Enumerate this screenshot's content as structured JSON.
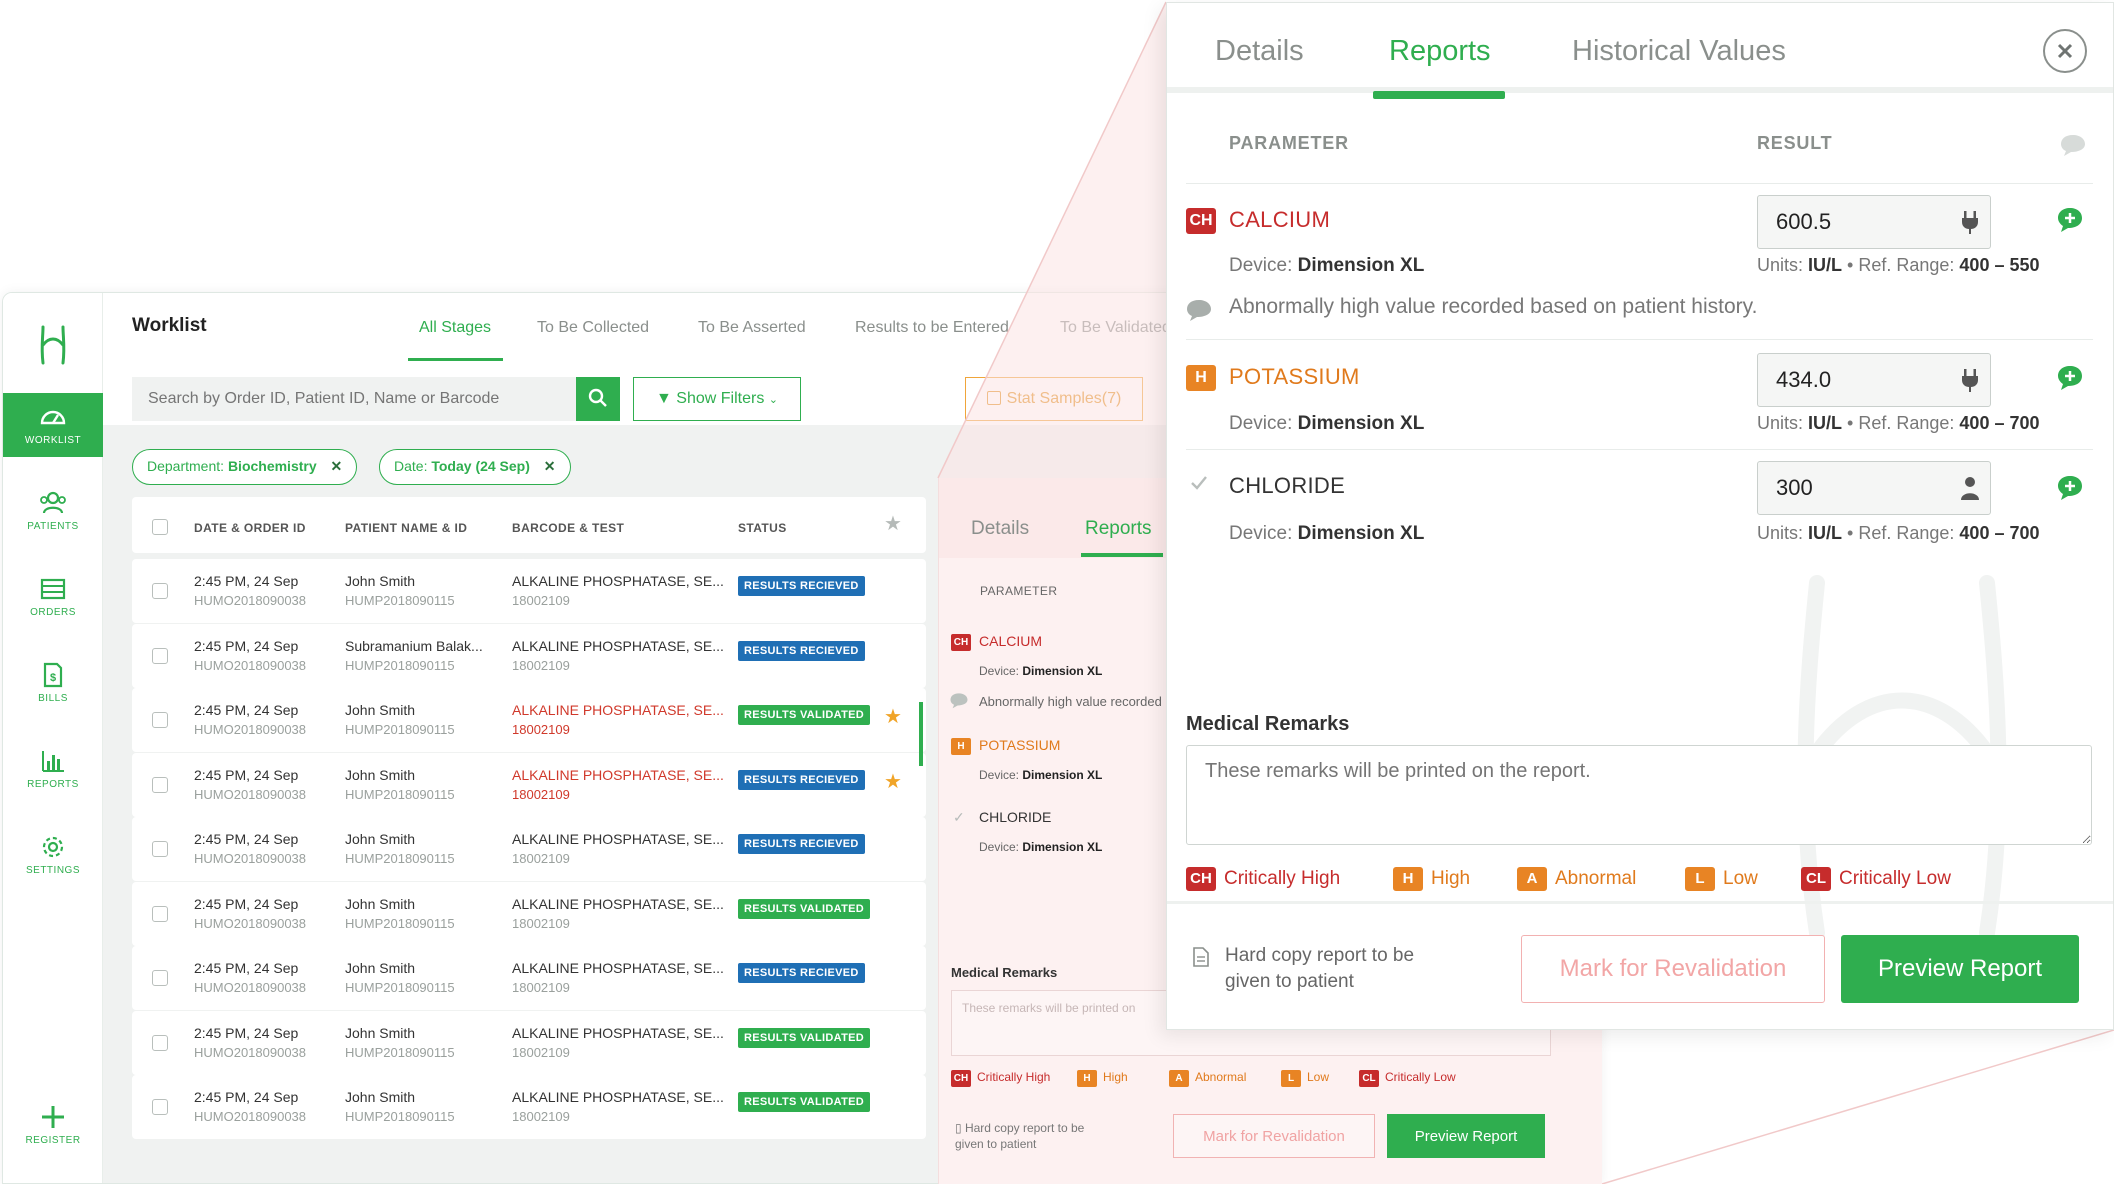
{
  "app": {
    "brand_color": "#2fae4f",
    "sidebar": [
      {
        "label": "WORKLIST",
        "icon": "gauge-icon",
        "active": true
      },
      {
        "label": "PATIENTS",
        "icon": "users-icon"
      },
      {
        "label": "ORDERS",
        "icon": "inbox-icon"
      },
      {
        "label": "BILLS",
        "icon": "bill-icon"
      },
      {
        "label": "REPORTS",
        "icon": "bar-chart-icon"
      },
      {
        "label": "SETTINGS",
        "icon": "gear-icon"
      },
      {
        "label": "REGISTER",
        "icon": "plus-icon"
      }
    ],
    "worklist": {
      "title": "Worklist",
      "stages": [
        "All Stages",
        "To Be Collected",
        "To Be Asserted",
        "Results to be Entered",
        "To Be Validated"
      ],
      "search_placeholder": "Search by Order ID, Patient ID, Name or Barcode",
      "show_filters": "Show Filters",
      "stat_samples": "Stat Samples(7)",
      "chips": [
        {
          "label": "Department:",
          "value": "Biochemistry"
        },
        {
          "label": "Date:",
          "value": "Today (24 Sep)"
        }
      ],
      "columns": [
        "DATE & ORDER ID",
        "PATIENT NAME & ID",
        "BARCODE & TEST",
        "STATUS"
      ],
      "rows": [
        {
          "date": "2:45 PM, 24 Sep",
          "order": "HUMO2018090038",
          "name": "John Smith",
          "pid": "HUMP2018090115",
          "test": "ALKALINE PHOSPHATASE, SE...",
          "barcode": "18002109",
          "status": "RESULTS RECIEVED",
          "kind": "rec",
          "red": false,
          "star": false
        },
        {
          "date": "2:45 PM, 24 Sep",
          "order": "HUMO2018090038",
          "name": "Subramanium Balak...",
          "pid": "HUMP2018090115",
          "test": "ALKALINE PHOSPHATASE, SE...",
          "barcode": "18002109",
          "status": "RESULTS RECIEVED",
          "kind": "rec",
          "red": false,
          "star": false
        },
        {
          "date": "2:45 PM, 24 Sep",
          "order": "HUMO2018090038",
          "name": "John Smith",
          "pid": "HUMP2018090115",
          "test": "ALKALINE PHOSPHATASE, SE...",
          "barcode": "18002109",
          "status": "RESULTS VALIDATED",
          "kind": "val",
          "red": true,
          "star": true
        },
        {
          "date": "2:45 PM, 24 Sep",
          "order": "HUMO2018090038",
          "name": "John Smith",
          "pid": "HUMP2018090115",
          "test": "ALKALINE PHOSPHATASE, SE...",
          "barcode": "18002109",
          "status": "RESULTS RECIEVED",
          "kind": "rec",
          "red": true,
          "star": true
        },
        {
          "date": "2:45 PM, 24 Sep",
          "order": "HUMO2018090038",
          "name": "John Smith",
          "pid": "HUMP2018090115",
          "test": "ALKALINE PHOSPHATASE, SE...",
          "barcode": "18002109",
          "status": "RESULTS RECIEVED",
          "kind": "rec",
          "red": false,
          "star": false
        },
        {
          "date": "2:45 PM, 24 Sep",
          "order": "HUMO2018090038",
          "name": "John Smith",
          "pid": "HUMP2018090115",
          "test": "ALKALINE PHOSPHATASE, SE...",
          "barcode": "18002109",
          "status": "RESULTS VALIDATED",
          "kind": "val",
          "red": false,
          "star": false
        },
        {
          "date": "2:45 PM, 24 Sep",
          "order": "HUMO2018090038",
          "name": "John Smith",
          "pid": "HUMP2018090115",
          "test": "ALKALINE PHOSPHATASE, SE...",
          "barcode": "18002109",
          "status": "RESULTS RECIEVED",
          "kind": "rec",
          "red": false,
          "star": false
        },
        {
          "date": "2:45 PM, 24 Sep",
          "order": "HUMO2018090038",
          "name": "John Smith",
          "pid": "HUMP2018090115",
          "test": "ALKALINE PHOSPHATASE, SE...",
          "barcode": "18002109",
          "status": "RESULTS VALIDATED",
          "kind": "val",
          "red": false,
          "star": false
        },
        {
          "date": "2:45 PM, 24 Sep",
          "order": "HUMO2018090038",
          "name": "John Smith",
          "pid": "HUMP2018090115",
          "test": "ALKALINE PHOSPHATASE, SE...",
          "barcode": "18002109",
          "status": "RESULTS VALIDATED",
          "kind": "val",
          "red": false,
          "star": false
        }
      ]
    }
  },
  "mini_panel": {
    "tabs": [
      "Details",
      "Reports"
    ],
    "param_header": "PARAMETER",
    "params": [
      {
        "tag": "CH",
        "name": "CALCIUM",
        "device_label": "Device:",
        "device": "Dimension XL"
      },
      {
        "tag": "H",
        "name": "POTASSIUM",
        "device_label": "Device:",
        "device": "Dimension XL"
      },
      {
        "tag": "",
        "name": "CHLORIDE",
        "device_label": "Device:",
        "device": "Dimension XL"
      }
    ],
    "remark": "Abnormally high value recorded",
    "remarks_label": "Medical Remarks",
    "remarks_placeholder": "These remarks will be printed on",
    "legend": [
      "Critically High",
      "High",
      "Abnormal",
      "Low",
      "Critically Low"
    ],
    "hard_copy": "Hard copy report to be given to patient",
    "mark_btn": "Mark for Revalidation",
    "preview_btn": "Preview Report"
  },
  "report_panel": {
    "tabs": [
      "Details",
      "Reports",
      "Historical Values"
    ],
    "active_tab": "Reports",
    "headers": {
      "parameter": "PARAMETER",
      "result": "RESULT"
    },
    "params": [
      {
        "tag": "CH",
        "name": "CALCIUM",
        "device_label": "Device:",
        "device": "Dimension XL",
        "value": "600.5",
        "input_icon": "plug-icon",
        "units_label": "Units:",
        "units": "IU/L",
        "range_label": "• Ref. Range:",
        "range": "400 – 550"
      },
      {
        "tag": "H",
        "name": "POTASSIUM",
        "device_label": "Device:",
        "device": "Dimension XL",
        "value": "434.0",
        "input_icon": "plug-icon",
        "units_label": "Units:",
        "units": "IU/L",
        "range_label": "• Ref. Range:",
        "range": "400 – 700"
      },
      {
        "tag": "",
        "name": "CHLORIDE",
        "device_label": "Device:",
        "device": "Dimension XL",
        "value": "300",
        "input_icon": "person-icon",
        "units_label": "Units:",
        "units": "IU/L",
        "range_label": "• Ref. Range:",
        "range": "400 – 700"
      }
    ],
    "calcium_remark": "Abnormally high value recorded based on patient history.",
    "remarks_label": "Medical Remarks",
    "remarks_placeholder": "These remarks will be printed on the report.",
    "legend": [
      {
        "tag": "CH",
        "label": "Critically High",
        "color": "#c62c2c"
      },
      {
        "tag": "H",
        "label": "High",
        "color": "#e88424"
      },
      {
        "tag": "A",
        "label": "Abnormal",
        "color": "#e88424"
      },
      {
        "tag": "L",
        "label": "Low",
        "color": "#e88424"
      },
      {
        "tag": "CL",
        "label": "Critically Low",
        "color": "#c62c2c"
      }
    ],
    "hard_copy": "Hard copy report to be given to patient",
    "mark_btn": "Mark for Revalidation",
    "preview_btn": "Preview Report"
  }
}
